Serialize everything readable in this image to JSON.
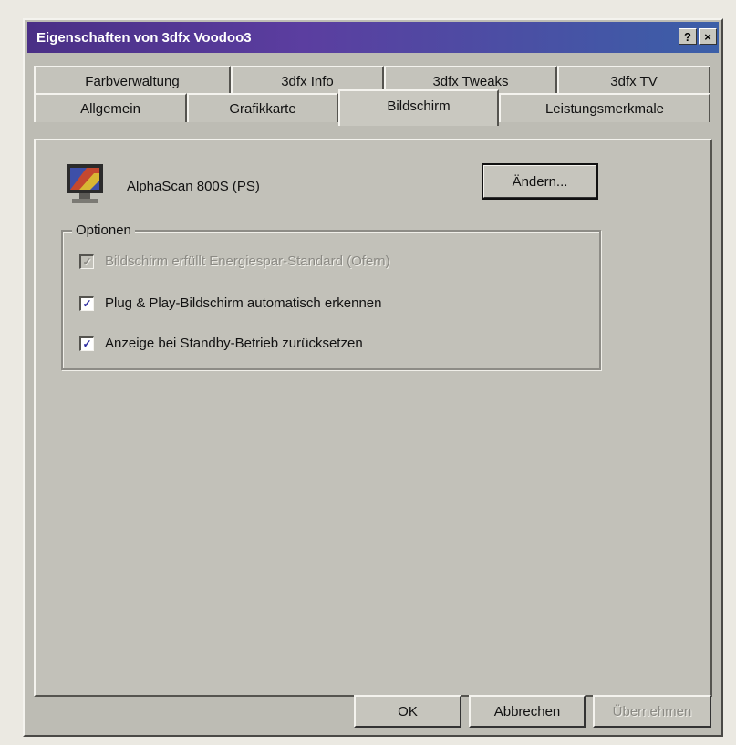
{
  "window": {
    "title": "Eigenschaften von 3dfx Voodoo3",
    "help_button": "?",
    "close_button": "×"
  },
  "tabs": {
    "row_back": [
      "Farbverwaltung",
      "3dfx Info",
      "3dfx Tweaks",
      "3dfx TV"
    ],
    "row_front": [
      "Allgemein",
      "Grafikkarte",
      "Bildschirm",
      "Leistungsmerkmale"
    ],
    "active": "Bildschirm"
  },
  "monitor": {
    "name": "AlphaScan 800S (PS)",
    "icon": "monitor-icon",
    "change_button": "Ändern..."
  },
  "options": {
    "legend": "Optionen",
    "items": [
      {
        "label": "Bildschirm erfüllt Energiespar-Standard (Ofern)",
        "checked": true,
        "enabled": false
      },
      {
        "label": "Plug & Play-Bildschirm automatisch erkennen",
        "checked": true,
        "enabled": true
      },
      {
        "label": "Anzeige bei Standby-Betrieb zurücksetzen",
        "checked": true,
        "enabled": true
      }
    ]
  },
  "footer": {
    "ok": "OK",
    "cancel": "Abbrechen",
    "apply": "Übernehmen"
  },
  "colors": {
    "titlebar_start": "#4a2f86",
    "titlebar_end": "#3b5fa8",
    "face": "#c2c1b9"
  }
}
